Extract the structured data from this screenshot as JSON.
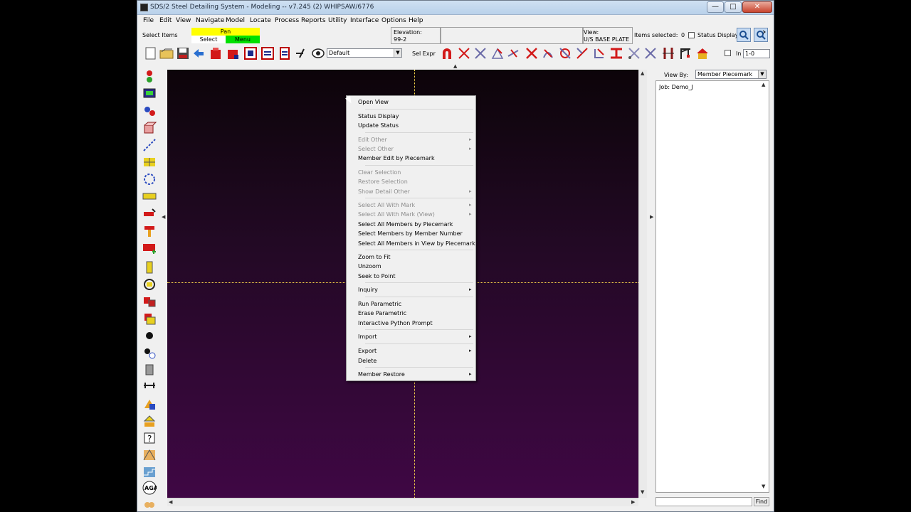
{
  "window": {
    "title": "SDS/2 Steel Detailing System - Modeling  --  v7.245  (2) WHIPSAW/6776",
    "controls": {
      "minimize": "—",
      "maximize": "□",
      "close": "✕"
    }
  },
  "menubar": [
    "File",
    "Edit",
    "View",
    "Navigate",
    "Model",
    "Locate",
    "Process",
    "Reports",
    "Utility",
    "Interface",
    "Options",
    "Help"
  ],
  "status": {
    "select_items": "Select Items",
    "pan": "Pan",
    "select": "Select",
    "menu": "Menu",
    "elevation_label": "Elevation:",
    "elevation_value": "99-2",
    "view_label": "View:",
    "view_value": "U/S BASE PLATE",
    "items_selected_label": "Items selected:",
    "items_selected_count": "0",
    "status_display": "Status Display"
  },
  "toolbar": {
    "default_combo": "Default",
    "sel_expr": "Sel Expr",
    "in_label": "In",
    "in_value": "1-0"
  },
  "right_panel": {
    "view_by_label": "View By:",
    "view_by_value": "Member Piecemark",
    "tree_item": "Job: Demo_J",
    "find_button": "Find"
  },
  "context_menu": {
    "groups": [
      [
        {
          "label": "Open View",
          "enabled": true
        }
      ],
      [
        {
          "label": "Status Display",
          "enabled": true
        },
        {
          "label": "Update Status",
          "enabled": true
        }
      ],
      [
        {
          "label": "Edit Other",
          "enabled": false,
          "submenu": true
        },
        {
          "label": "Select Other",
          "enabled": false,
          "submenu": true
        },
        {
          "label": "Member Edit by Piecemark",
          "enabled": true
        }
      ],
      [
        {
          "label": "Clear Selection",
          "enabled": false
        },
        {
          "label": "Restore Selection",
          "enabled": false
        },
        {
          "label": "Show Detail Other",
          "enabled": false,
          "submenu": true
        }
      ],
      [
        {
          "label": "Select All With Mark",
          "enabled": false,
          "submenu": true
        },
        {
          "label": "Select All With Mark (View)",
          "enabled": false,
          "submenu": true
        },
        {
          "label": "Select All Members by Piecemark",
          "enabled": true
        },
        {
          "label": "Select Members by Member Number",
          "enabled": true
        },
        {
          "label": "Select All Members in View by Piecemark",
          "enabled": true
        }
      ],
      [
        {
          "label": "Zoom to Fit",
          "enabled": true
        },
        {
          "label": "Unzoom",
          "enabled": true
        },
        {
          "label": "Seek to Point",
          "enabled": true
        }
      ],
      [
        {
          "label": "Inquiry",
          "enabled": true,
          "submenu": true
        }
      ],
      [
        {
          "label": "Run Parametric",
          "enabled": true
        },
        {
          "label": "Erase Parametric",
          "enabled": true
        },
        {
          "label": "Interactive Python Prompt",
          "enabled": true
        }
      ],
      [
        {
          "label": "Import",
          "enabled": true,
          "submenu": true
        }
      ],
      [
        {
          "label": "Export",
          "enabled": true,
          "submenu": true
        },
        {
          "label": "Delete",
          "enabled": true
        }
      ],
      [
        {
          "label": "Member Restore",
          "enabled": true,
          "submenu": true
        }
      ]
    ]
  },
  "icons": {
    "toolbar": [
      "new-file-icon",
      "open-folder-icon",
      "save-icon",
      "undo-icon",
      "red-box-icon",
      "red-box-edit-icon",
      "view-window-icon",
      "view-grid-icon",
      "view-bar-icon",
      "slash-icon",
      "eye-icon",
      "magnet-icon",
      "cross-select-icon",
      "cross-select-2-icon",
      "angle-icon",
      "measure-icon",
      "cross-red-icon",
      "arc-select-icon",
      "circle-select-icon",
      "line-select-icon",
      "corner-select-icon",
      "beam-icon",
      "scissors-icon",
      "cross-select-3-icon",
      "column-icon",
      "crane-icon",
      "house-icon"
    ],
    "palette": [
      "member-status-icon",
      "monitor-icon",
      "gear-icon",
      "box-icon",
      "line-icon",
      "grid-icon",
      "circle-icon",
      "ruler-icon",
      "flag-icon",
      "hammer-icon",
      "pcs-icon",
      "bolt-icon",
      "rotate-icon",
      "material-icon",
      "sheet-icon",
      "dot-icon",
      "node-icon",
      "cylinder-icon",
      "dimension-icon",
      "arrow-icon",
      "layers-icon",
      "question-icon",
      "truss-icon",
      "stairs-icon",
      "aga-icon",
      "hands-icon"
    ]
  },
  "colors": {
    "pan_bg": "#ffff00",
    "menu_bg": "#00e000",
    "crosshair": "#ffd84a",
    "canvas_top": "#0c0409",
    "canvas_bottom": "#3f0744"
  }
}
